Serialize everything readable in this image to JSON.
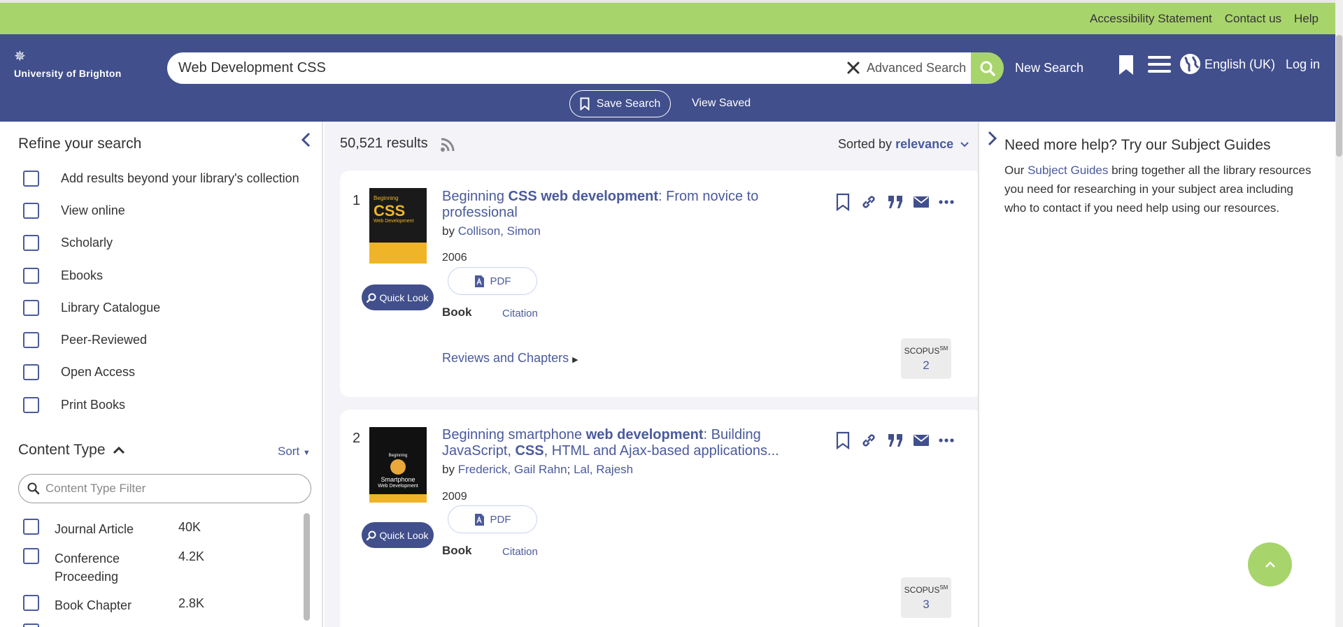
{
  "utility": {
    "links": [
      "Accessibility Statement",
      "Contact us",
      "Help"
    ]
  },
  "header": {
    "logo_text": "University of Brighton",
    "search_value": "Web Development CSS",
    "advanced_search": "Advanced Search",
    "new_search": "New Search",
    "language": "English (UK)",
    "login": "Log in",
    "save_search": "Save Search",
    "view_saved": "View Saved"
  },
  "sidebar": {
    "title": "Refine your search",
    "filters": [
      "Add results beyond your library's collection",
      "View online",
      "Scholarly",
      "Ebooks",
      "Library Catalogue",
      "Peer-Reviewed",
      "Open Access",
      "Print Books"
    ],
    "content_type": {
      "title": "Content Type",
      "sort": "Sort",
      "filter_placeholder": "Content Type Filter",
      "items": [
        {
          "label": "Journal Article",
          "count": "40K"
        },
        {
          "label": "Conference Proceeding",
          "count": "4.2K"
        },
        {
          "label": "Book Chapter",
          "count": "2.8K"
        }
      ]
    }
  },
  "results": {
    "count": "50,521 results",
    "sorted_label": "Sorted by",
    "sorted_value": "relevance",
    "items": [
      {
        "index": "1",
        "title_parts": [
          "Beginning ",
          "CSS web development",
          ": From novice to professional"
        ],
        "by": "by",
        "authors": [
          "Collison, Simon"
        ],
        "year": "2006",
        "pdf": "PDF",
        "type": "Book",
        "citation": "Citation",
        "reviews": "Reviews and Chapters",
        "scopus_label": "SCOPUS",
        "scopus_sup": "SM",
        "scopus_count": "2",
        "quick_look": "Quick Look",
        "cover_title": "CSS",
        "cover_sub": "Web Development",
        "cover_color": "#f0b429"
      },
      {
        "index": "2",
        "title_parts": [
          "Beginning smartphone ",
          "web development",
          ": Building JavaScript, ",
          "CSS",
          ", HTML and Ajax-based applications..."
        ],
        "by": "by",
        "authors": [
          "Frederick, Gail Rahn",
          "Lal, Rajesh"
        ],
        "year": "2009",
        "pdf": "PDF",
        "type": "Book",
        "citation": "Citation",
        "scopus_label": "SCOPUS",
        "scopus_sup": "SM",
        "scopus_count": "3",
        "quick_look": "Quick Look",
        "cover_title": "Smartphone",
        "cover_sub": "Web Development",
        "cover_color": "#111111"
      }
    ]
  },
  "help": {
    "title": "Need more help? Try our Subject Guides",
    "text_before": "Our ",
    "link": "Subject Guides",
    "text_after": " bring together all the library resources you need for researching in your subject area including who to contact if you need help using our resources."
  },
  "colors": {
    "accent_green": "#a8d46c",
    "header_blue": "#414f8c",
    "link_blue": "#4a5a9c"
  }
}
